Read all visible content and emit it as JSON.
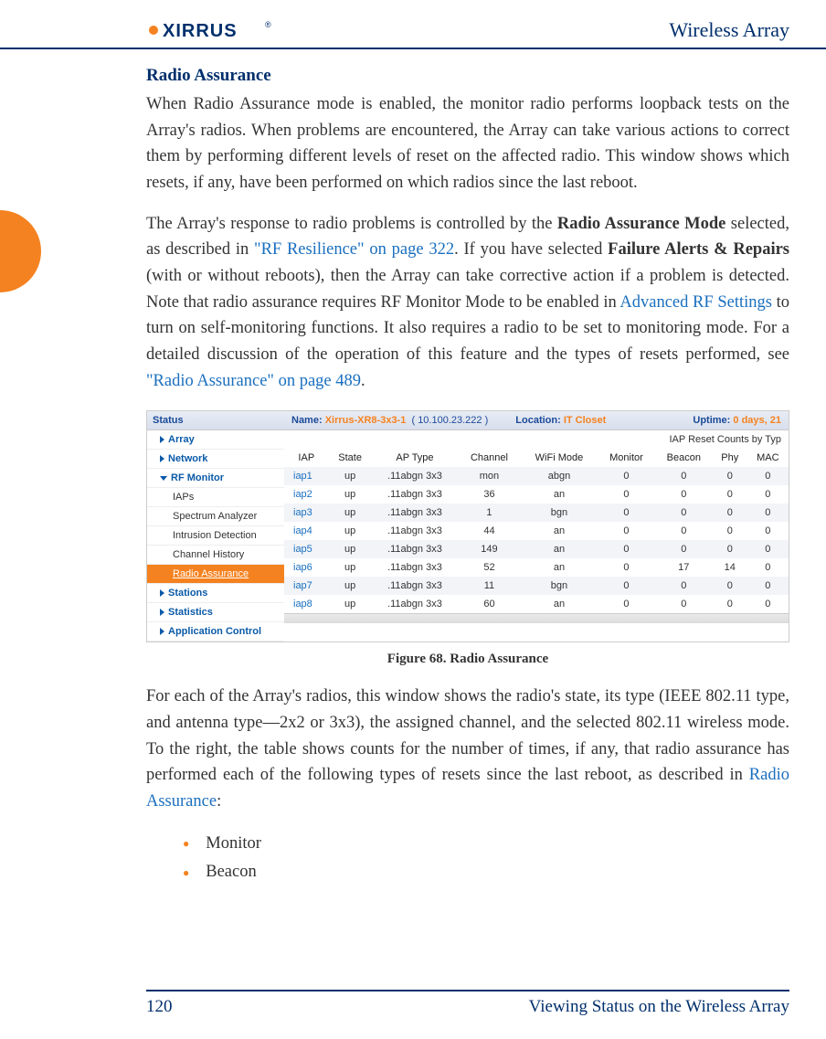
{
  "header": {
    "doc_title": "Wireless Array"
  },
  "section": {
    "title": "Radio Assurance",
    "p1a": "When Radio Assurance mode is enabled, the monitor radio performs loopback tests on the Array's radios. When problems are encountered, the Array can take various actions to correct them by performing different levels of reset on the affected radio. This window shows which resets, if any, have been performed on which radios since the last reboot.",
    "p2_pre": "The Array's response to radio problems is controlled by the ",
    "p2_b1": "Radio Assurance Mode",
    "p2_mid1": " selected, as described in ",
    "p2_link1": "\"RF Resilience\" on page 322",
    "p2_mid2": ". If you have selected ",
    "p2_b2": "Failure Alerts & Repairs",
    "p2_mid3": " (with or without reboots), then the Array can take corrective action if a problem is detected. Note that radio assurance requires RF Monitor Mode to be enabled in ",
    "p2_link2": "Advanced RF Settings",
    "p2_mid4": " to turn on self-monitoring functions. It also requires a radio to be set to monitoring mode. For a detailed discussion of the operation of this feature and the types of resets performed, see ",
    "p2_link3": "\"Radio Assurance\" on page 489",
    "p2_end": ".",
    "figure_caption": "Figure 68. Radio Assurance",
    "p3_pre": "For each of the Array's radios, this window shows the radio's state, its type (IEEE 802.11 type, and antenna type—2x2 or 3x3), the assigned channel, and the selected 802.11 wireless mode. To the right, the table shows counts for the number of times, if any, that radio assurance has performed each of the following types of resets since the last reboot, as described in ",
    "p3_link": "Radio Assurance",
    "p3_end": ":",
    "bullets": [
      "Monitor",
      "Beacon"
    ]
  },
  "screenshot": {
    "nav_header": "Status",
    "nav_items": [
      {
        "label": "Array",
        "type": "top-collapsed"
      },
      {
        "label": "Network",
        "type": "top-collapsed"
      },
      {
        "label": "RF Monitor",
        "type": "top-expanded"
      },
      {
        "label": "IAPs",
        "type": "sub"
      },
      {
        "label": "Spectrum Analyzer",
        "type": "sub"
      },
      {
        "label": "Intrusion Detection",
        "type": "sub"
      },
      {
        "label": "Channel History",
        "type": "sub"
      },
      {
        "label": "Radio Assurance",
        "type": "sub-selected"
      },
      {
        "label": "Stations",
        "type": "top-collapsed"
      },
      {
        "label": "Statistics",
        "type": "top-collapsed"
      },
      {
        "label": "Application Control",
        "type": "top-collapsed"
      }
    ],
    "topbar": {
      "name_label": "Name:",
      "name_val": "Xirrus-XR8-3x3-1",
      "name_ip": "( 10.100.23.222 )",
      "loc_label": "Location:",
      "loc_val": "IT Closet",
      "up_label": "Uptime:",
      "up_val": "0 days, 21"
    },
    "subhead": "IAP Reset Counts by Typ",
    "columns": [
      "IAP",
      "State",
      "AP Type",
      "Channel",
      "WiFi Mode",
      "Monitor",
      "Beacon",
      "Phy",
      "MAC"
    ],
    "rows": [
      [
        "iap1",
        "up",
        ".11abgn 3x3",
        "mon",
        "abgn",
        "0",
        "0",
        "0",
        "0"
      ],
      [
        "iap2",
        "up",
        ".11abgn 3x3",
        "36",
        "an",
        "0",
        "0",
        "0",
        "0"
      ],
      [
        "iap3",
        "up",
        ".11abgn 3x3",
        "1",
        "bgn",
        "0",
        "0",
        "0",
        "0"
      ],
      [
        "iap4",
        "up",
        ".11abgn 3x3",
        "44",
        "an",
        "0",
        "0",
        "0",
        "0"
      ],
      [
        "iap5",
        "up",
        ".11abgn 3x3",
        "149",
        "an",
        "0",
        "0",
        "0",
        "0"
      ],
      [
        "iap6",
        "up",
        ".11abgn 3x3",
        "52",
        "an",
        "0",
        "17",
        "14",
        "0"
      ],
      [
        "iap7",
        "up",
        ".11abgn 3x3",
        "11",
        "bgn",
        "0",
        "0",
        "0",
        "0"
      ],
      [
        "iap8",
        "up",
        ".11abgn 3x3",
        "60",
        "an",
        "0",
        "0",
        "0",
        "0"
      ]
    ]
  },
  "footer": {
    "page_num": "120",
    "chapter": "Viewing Status on the Wireless Array"
  }
}
